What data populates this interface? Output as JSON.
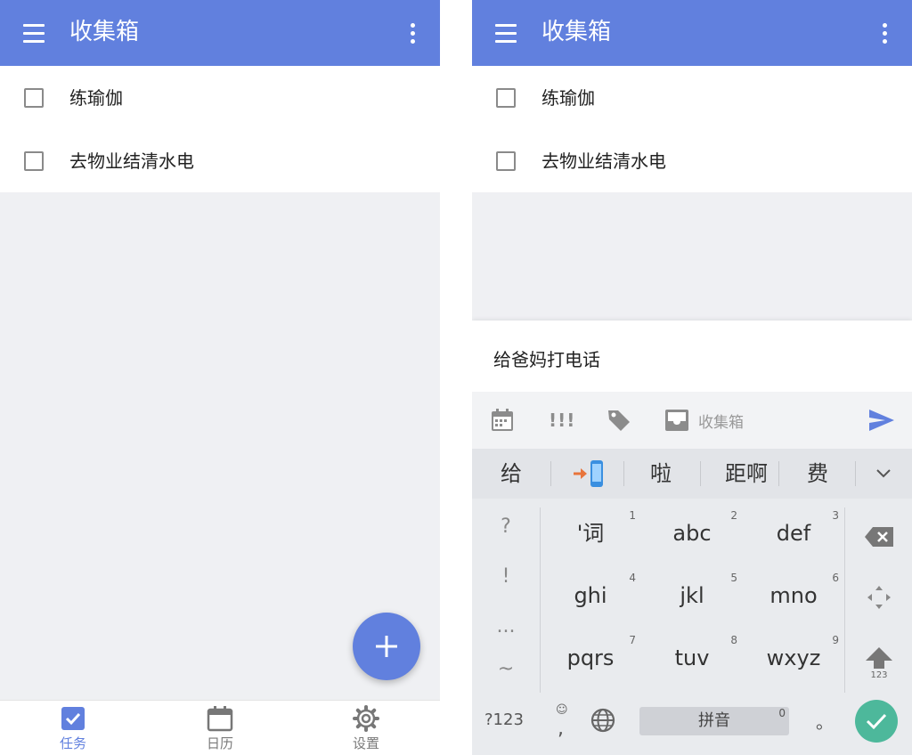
{
  "colors": {
    "primary": "#6180de",
    "background": "#eff0f3",
    "enter": "#4db89b"
  },
  "left": {
    "app_bar": {
      "title": "收集箱",
      "menu_icon": "hamburger-menu-icon",
      "more_icon": "more-vertical-icon"
    },
    "tasks": [
      {
        "label": "练瑜伽",
        "checked": false
      },
      {
        "label": "去物业结清水电",
        "checked": false
      }
    ],
    "fab_icon": "plus-icon",
    "bottom_nav": [
      {
        "label": "任务",
        "icon": "checkbox-icon",
        "active": true
      },
      {
        "label": "日历",
        "icon": "calendar-icon",
        "active": false
      },
      {
        "label": "设置",
        "icon": "gear-icon",
        "active": false
      }
    ]
  },
  "right": {
    "app_bar": {
      "title": "收集箱",
      "menu_icon": "hamburger-menu-icon",
      "more_icon": "more-vertical-icon"
    },
    "tasks": [
      {
        "label": "练瑜伽",
        "checked": false
      },
      {
        "label": "去物业结清水电",
        "checked": false
      }
    ],
    "composer": {
      "input_value": "给爸妈打电话",
      "toolbar": {
        "priority": "!!!",
        "project": "收集箱"
      }
    },
    "keyboard": {
      "candidates": [
        "给",
        "啦",
        "距啊",
        "费"
      ],
      "symbols": [
        "?",
        "!",
        "...",
        "~"
      ],
      "keys": [
        {
          "label": "'词",
          "num": "1"
        },
        {
          "label": "abc",
          "num": "2"
        },
        {
          "label": "def",
          "num": "3"
        },
        {
          "label": "ghi",
          "num": "4"
        },
        {
          "label": "jkl",
          "num": "5"
        },
        {
          "label": "mno",
          "num": "6"
        },
        {
          "label": "pqrs",
          "num": "7"
        },
        {
          "label": "tuv",
          "num": "8"
        },
        {
          "label": "wxyz",
          "num": "9"
        }
      ],
      "shift_sub": "123",
      "bottom": {
        "mode": "?123",
        "emoji": "☺",
        "comma": ",",
        "space": "拼音",
        "space_num": "0",
        "period": "。"
      }
    }
  }
}
